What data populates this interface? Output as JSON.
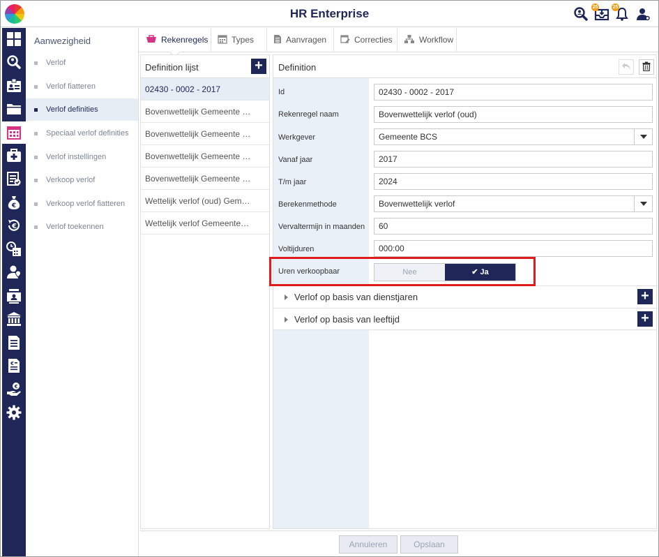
{
  "app": {
    "title": "HR Enterprise"
  },
  "header": {
    "icons": [
      "search-user-icon",
      "inbox-icon",
      "bell-icon",
      "user-settings-icon"
    ],
    "badges": [
      "25",
      "25"
    ]
  },
  "rail": {
    "icons": [
      "dashboard-icon",
      "search-user-icon",
      "id-card-icon",
      "folder-icon",
      "calendar-icon",
      "medical-kit-icon",
      "checklist-icon",
      "money-bag-icon",
      "euro-refresh-icon",
      "time-calendar-icon",
      "person-pin-icon",
      "contact-card-icon",
      "bank-icon",
      "document-icon",
      "euro-document-icon",
      "hand-coin-icon",
      "gear-icon"
    ],
    "active_index": 4
  },
  "submenu": {
    "title": "Aanwezigheid",
    "items": [
      {
        "label": "Verlof"
      },
      {
        "label": "Verlof fiatteren"
      },
      {
        "label": "Verlof definities"
      },
      {
        "label": "Speciaal verlof definities"
      },
      {
        "label": "Verlof instellingen"
      },
      {
        "label": "Verkoop verlof"
      },
      {
        "label": "Verkoop verlof fiatteren"
      },
      {
        "label": "Verlof toekennen"
      }
    ],
    "active_index": 2
  },
  "tabs": [
    {
      "label": "Rekenregels",
      "icon": "cart-icon"
    },
    {
      "label": "Types",
      "icon": "calendar-grid-icon"
    },
    {
      "label": "Aanvragen",
      "icon": "document-list-icon"
    },
    {
      "label": "Correcties",
      "icon": "calendar-edit-icon"
    },
    {
      "label": "Workflow",
      "icon": "workflow-icon"
    }
  ],
  "list": {
    "title": "Definition lijst",
    "rows": [
      "02430 - 0002 - 2017",
      "Bovenwettelijk Gemeente …",
      "Bovenwettelijk Gemeente …",
      "Bovenwettelijk Gemeente …",
      "Bovenwettelijk Gemeente …",
      "Wettelijk verlof (oud) Gem…",
      "Wettelijk verlof Gemeente…"
    ]
  },
  "detail": {
    "title": "Definition",
    "fields": [
      {
        "label": "Id",
        "value": "02430 - 0002 - 2017"
      },
      {
        "label": "Rekenregel naam",
        "value": "Bovenwettelijk verlof (oud)"
      },
      {
        "label": "Werkgever",
        "value": "Gemeente BCS",
        "dropdown": true
      },
      {
        "label": "Vanaf jaar",
        "value": "2017"
      },
      {
        "label": "T/m jaar",
        "value": "2024"
      },
      {
        "label": "Berekenmethode",
        "value": "Bovenwettelijk verlof",
        "dropdown": true
      },
      {
        "label": "Vervaltermijn in maanden",
        "value": "60"
      },
      {
        "label": "Voltijduren",
        "value": "000:00"
      }
    ],
    "toggle": {
      "label": "Uren verkoopbaar",
      "off": "Nee",
      "on": "Ja",
      "selected": "Ja"
    },
    "sections": [
      {
        "label": "Verlof op basis van dienstjaren"
      },
      {
        "label": "Verlof op basis van leeftijd"
      }
    ]
  },
  "footer": {
    "cancel": "Annuleren",
    "save": "Opslaan"
  },
  "colors": {
    "navy": "#1e2757",
    "highlight": "#e01b1b",
    "active_row": "#e6edf5"
  }
}
